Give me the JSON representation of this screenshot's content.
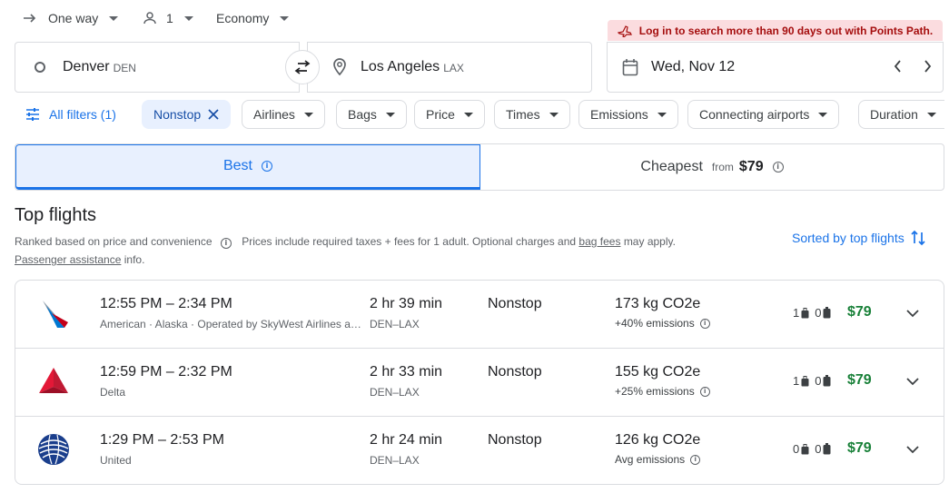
{
  "trip": {
    "type": "One way",
    "passengers": "1",
    "cabin": "Economy"
  },
  "banner": "Log in to search more than 90 days out with Points Path.",
  "search": {
    "origin_city": "Denver",
    "origin_code": "DEN",
    "dest_city": "Los Angeles",
    "dest_code": "LAX",
    "date": "Wed, Nov 12"
  },
  "filters": {
    "all": "All filters (1)",
    "chips": [
      "Nonstop",
      "Airlines",
      "Bags",
      "Price",
      "Times",
      "Emissions",
      "Connecting airports",
      "Duration"
    ]
  },
  "sort_tabs": {
    "best": "Best",
    "cheapest": "Cheapest",
    "from": "from",
    "cheapest_price": "$79"
  },
  "results": {
    "title": "Top flights",
    "subtitle_ranked": "Ranked based on price and convenience",
    "subtitle_prices_a": "Prices include required taxes + fees for 1 adult. Optional charges and",
    "subtitle_bagfees": "bag fees",
    "subtitle_prices_b": "may apply.",
    "passenger_assistance": "Passenger assistance",
    "info_word": "info.",
    "sorted_by": "Sorted by top flights"
  },
  "flights": [
    {
      "times": "12:55 PM – 2:34 PM",
      "airline": "American · Alaska · Operated by SkyWest Airlines as American Eagle",
      "duration": "2 hr 39 min",
      "route": "DEN–LAX",
      "stops": "Nonstop",
      "co2": "173 kg CO2e",
      "emissions": "+40% emissions",
      "carry_on": "1",
      "checked": "0",
      "price": "$79",
      "logo": "american-logo"
    },
    {
      "times": "12:59 PM – 2:32 PM",
      "airline": "Delta",
      "duration": "2 hr 33 min",
      "route": "DEN–LAX",
      "stops": "Nonstop",
      "co2": "155 kg CO2e",
      "emissions": "+25% emissions",
      "carry_on": "1",
      "checked": "0",
      "price": "$79",
      "logo": "delta-logo"
    },
    {
      "times": "1:29 PM – 2:53 PM",
      "airline": "United",
      "duration": "2 hr 24 min",
      "route": "DEN–LAX",
      "stops": "Nonstop",
      "co2": "126 kg CO2e",
      "emissions": "Avg emissions",
      "carry_on": "0",
      "checked": "0",
      "price": "$79",
      "logo": "united-logo"
    }
  ],
  "colors": {
    "accent": "#1a73e8",
    "price_green": "#188038",
    "banner_bg": "#fbdcdf",
    "banner_text": "#a50e0e"
  }
}
